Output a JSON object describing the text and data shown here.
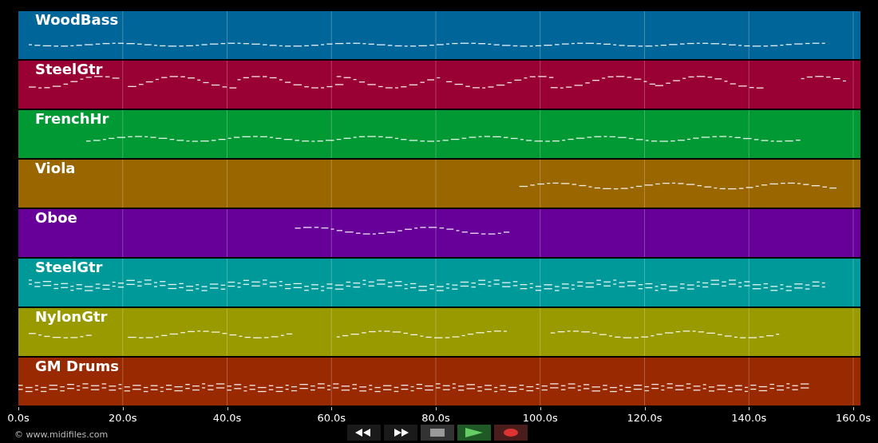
{
  "tracks": [
    {
      "name": "WoodBass",
      "color": "#006699"
    },
    {
      "name": "SteelGtr",
      "color": "#990033"
    },
    {
      "name": "FrenchHr",
      "color": "#009933"
    },
    {
      "name": "Viola",
      "color": "#996600"
    },
    {
      "name": "Oboe",
      "color": "#660099"
    },
    {
      "name": "SteelGtr",
      "color": "#009999"
    },
    {
      "name": "NylonGtr",
      "color": "#999900"
    },
    {
      "name": "GM Drums",
      "color": "#992900"
    }
  ],
  "time_axis": [
    "0.0s",
    "20.0s",
    "40.0s",
    "60.0s",
    "80.0s",
    "100.0s",
    "120.0s",
    "140.0s",
    "160.0s"
  ],
  "credit": "© www.midifiles.com",
  "transport": [
    {
      "kind": "rewind"
    },
    {
      "kind": "forward"
    },
    {
      "kind": "stop"
    },
    {
      "kind": "play"
    },
    {
      "kind": "record"
    }
  ]
}
